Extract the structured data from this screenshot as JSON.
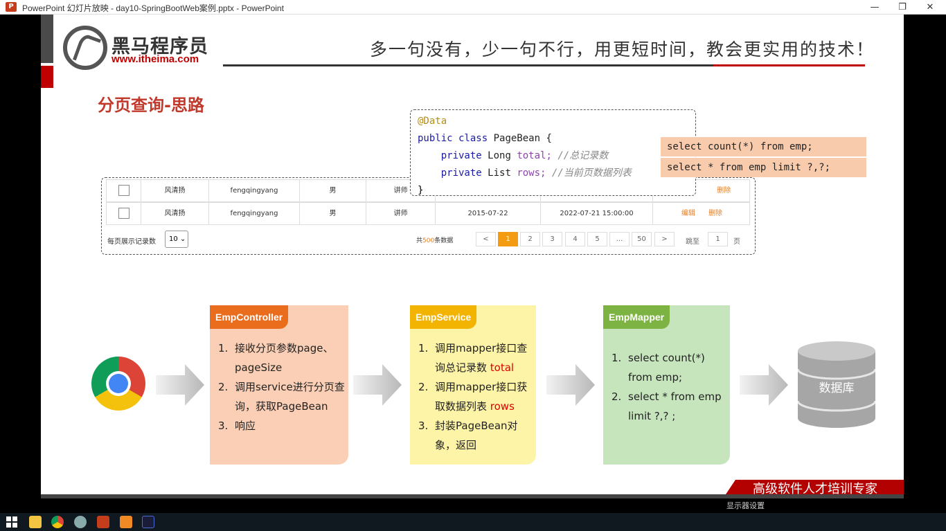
{
  "window": {
    "title": "PowerPoint 幻灯片放映 - day10-SpringBootWeb案例.pptx - PowerPoint",
    "app_icon": "P",
    "minimize": "—",
    "restore": "❐",
    "close": "✕"
  },
  "header": {
    "logo_cn": "黑马程序员",
    "logo_url": "www.itheima.com",
    "slogan": "多一句没有，少一句不行，用更短时间，教会更实用的技术！"
  },
  "heading": "分页查询-思路",
  "code": {
    "annotation": "@Data",
    "class_decl_kw": "public class",
    "class_name": "PageBean {",
    "field1_kw": "private",
    "field1_type": "Long",
    "field1_name": "total;",
    "field1_comment": "//总记录数",
    "field2_kw": "private",
    "field2_type": "List",
    "field2_name": "rows;",
    "field2_comment": "//当前页数据列表",
    "close": "}"
  },
  "sql": {
    "count": "select count(*) from emp;",
    "page": "select * from emp limit ?,?;"
  },
  "table": {
    "rows": [
      {
        "name": "风清扬",
        "username": "fengqingyang",
        "gender": "男",
        "job": "讲师",
        "entry": "",
        "update": "",
        "edit": "",
        "delete": "删除"
      },
      {
        "name": "风清扬",
        "username": "fengqingyang",
        "gender": "男",
        "job": "讲师",
        "entry": "2015-07-22",
        "update": "2022-07-21 15:00:00",
        "edit": "编辑",
        "delete": "删除"
      }
    ]
  },
  "pager": {
    "page_size_label": "每页展示记录数",
    "page_size": "10",
    "total_prefix": "共",
    "total_num": "500",
    "total_suffix": "条数据",
    "prev": "<",
    "pages": [
      "1",
      "2",
      "3",
      "4",
      "5",
      "...",
      "50"
    ],
    "next": ">",
    "goto_label": "跳至",
    "goto_value": "1",
    "goto_suffix": "页"
  },
  "flow": {
    "controller": {
      "title": "EmpController",
      "items": [
        {
          "n": "1.",
          "text": "接收分页参数page、pageSize",
          "extra": ""
        },
        {
          "n": "2.",
          "text": "调用service进行分页查询，获取PageBean",
          "extra": ""
        },
        {
          "n": "3.",
          "text": "响应",
          "extra": ""
        }
      ]
    },
    "service": {
      "title": "EmpService",
      "items": [
        {
          "n": "1.",
          "text": "调用mapper接口查询总记录数",
          "extra": "total"
        },
        {
          "n": "2.",
          "text": "调用mapper接口获取数据列表",
          "extra": "rows"
        },
        {
          "n": "3.",
          "text": "封装PageBean对象，返回",
          "extra": ""
        }
      ]
    },
    "mapper": {
      "title": "EmpMapper",
      "items": [
        {
          "n": "1.",
          "text": "select count(*) from emp;",
          "extra": ""
        },
        {
          "n": "2.",
          "text": "select * from emp limit ?,? ;",
          "extra": ""
        }
      ]
    },
    "database": "数据库"
  },
  "banner": "高级软件人才培训专家",
  "ppt_controls": {
    "display_settings": "显示器设置"
  },
  "colors": {
    "brand_red": "#c00000",
    "controller": "#fbcfb5",
    "controller_head": "#ea6d1e",
    "service": "#fdf4a7",
    "service_head": "#f2b400",
    "mapper": "#c6e5bd",
    "mapper_head": "#7cb342"
  }
}
